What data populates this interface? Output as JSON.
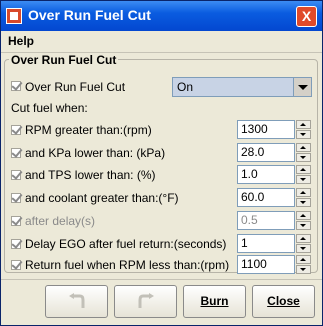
{
  "window": {
    "title": "Over Run Fuel Cut",
    "close_glyph": "X"
  },
  "menu": {
    "help": "Help"
  },
  "group": {
    "title": "Over Run Fuel Cut"
  },
  "enable": {
    "label": "Over Run Fuel Cut",
    "value": "On"
  },
  "cut_fuel_when": "Cut fuel when:",
  "fields": [
    {
      "label": "RPM greater than:(rpm)",
      "value": "1300",
      "enabled": true
    },
    {
      "label": "and KPa lower than:  (kPa)",
      "value": "28.0",
      "enabled": true
    },
    {
      "label": "and TPS lower than:  (%)",
      "value": "1.0",
      "enabled": true
    },
    {
      "label": "and coolant greater than:(°F)",
      "value": "60.0",
      "enabled": true
    },
    {
      "label": "after delay(s)",
      "value": "0.5",
      "enabled": false
    },
    {
      "label": "Delay EGO after fuel return:(seconds)",
      "value": "1",
      "enabled": true
    },
    {
      "label": "Return fuel when RPM less than:(rpm)",
      "value": "1100",
      "enabled": true
    }
  ],
  "buttons": {
    "burn": "Burn",
    "close": "Close"
  },
  "icons": {
    "undo": "undo-icon",
    "redo": "redo-icon",
    "window": "app-icon",
    "check": "check-icon"
  }
}
